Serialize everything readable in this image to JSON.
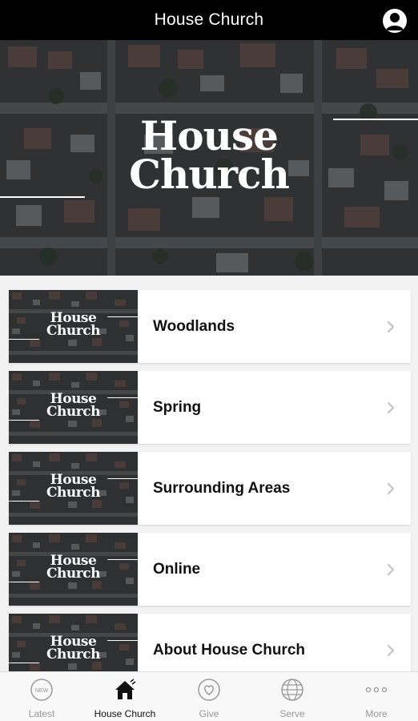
{
  "header": {
    "title": "House Church",
    "profile_icon": "person-circle-icon"
  },
  "hero": {
    "logo_line1": "House",
    "logo_line2": "Church"
  },
  "items": [
    {
      "label": "Woodlands",
      "thumb_line1": "House",
      "thumb_line2": "Church"
    },
    {
      "label": "Spring",
      "thumb_line1": "House",
      "thumb_line2": "Church"
    },
    {
      "label": "Surrounding Areas",
      "thumb_line1": "House",
      "thumb_line2": "Church"
    },
    {
      "label": "Online",
      "thumb_line1": "House",
      "thumb_line2": "Church"
    },
    {
      "label": "About House Church",
      "thumb_line1": "House",
      "thumb_line2": "Church"
    }
  ],
  "tabs": [
    {
      "label": "Latest",
      "icon": "new-badge-icon",
      "badge": "NEW",
      "active": false
    },
    {
      "label": "House Church",
      "icon": "house-icon",
      "active": true
    },
    {
      "label": "Give",
      "icon": "heart-icon",
      "active": false
    },
    {
      "label": "Serve",
      "icon": "globe-icon",
      "active": false
    },
    {
      "label": "More",
      "icon": "more-dots-icon",
      "active": false
    }
  ],
  "colors": {
    "topbar": "#000000",
    "accent": "#111111",
    "inactive_tab": "#9a9a9a"
  }
}
